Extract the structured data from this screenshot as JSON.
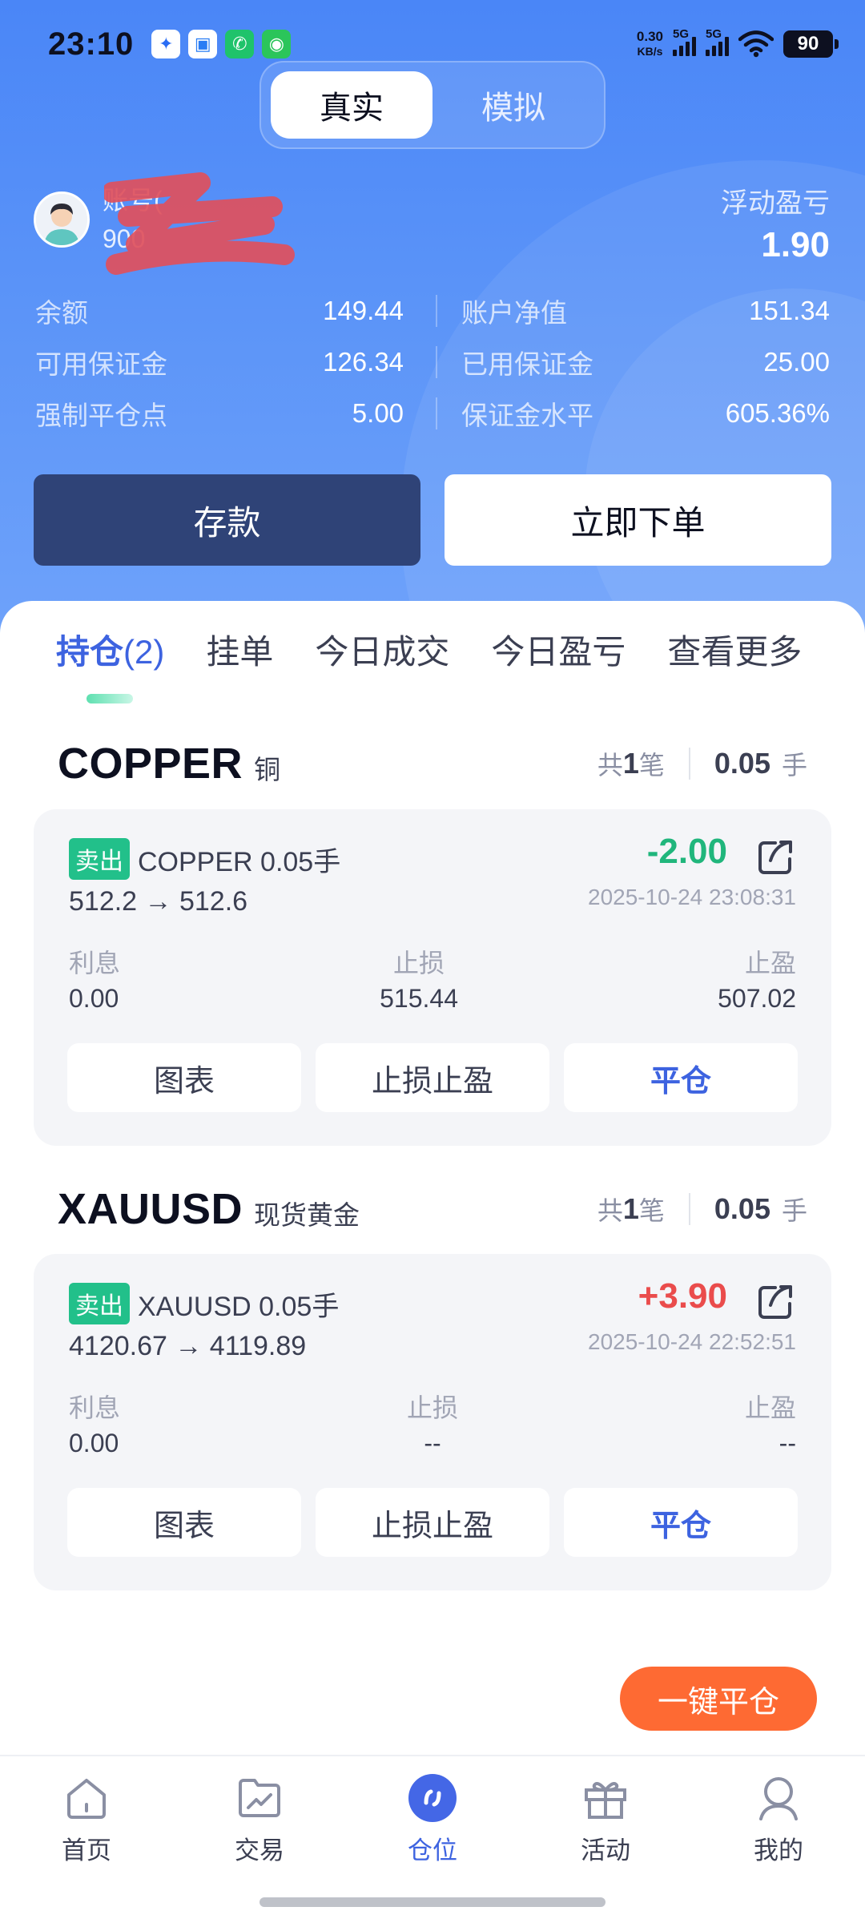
{
  "status_bar": {
    "time": "23:10",
    "net_speed_value": "0.30",
    "net_speed_unit": "KB/s",
    "sim1": "5G",
    "sim2": "5G",
    "battery": "90"
  },
  "mode_toggle": {
    "real": "真实",
    "simulated": "模拟",
    "selected": "真实"
  },
  "account": {
    "label": "账号(",
    "number": "900",
    "floating_pnl_label": "浮动盈亏",
    "floating_pnl_value": "1.90"
  },
  "stats": {
    "balance": {
      "label": "余额",
      "value": "149.44"
    },
    "equity": {
      "label": "账户净值",
      "value": "151.34"
    },
    "free_margin": {
      "label": "可用保证金",
      "value": "126.34"
    },
    "used_margin": {
      "label": "已用保证金",
      "value": "25.00"
    },
    "stop_out": {
      "label": "强制平仓点",
      "value": "5.00"
    },
    "margin_level": {
      "label": "保证金水平",
      "value": "605.36%"
    }
  },
  "actions": {
    "deposit": "存款",
    "place_order": "立即下单"
  },
  "tabs": [
    {
      "label": "持仓",
      "count": "(2)",
      "active": true
    },
    {
      "label": "挂单"
    },
    {
      "label": "今日成交"
    },
    {
      "label": "今日盈亏"
    },
    {
      "label": "查看更多"
    }
  ],
  "positions": [
    {
      "symbol": "COPPER",
      "symbol_cn": "铜",
      "count_prefix": "共",
      "count": "1",
      "count_suffix": "笔",
      "lots": "0.05",
      "lots_unit": "手",
      "side": "卖出",
      "title": "COPPER  0.05手",
      "prices": "512.2 → 512.6",
      "pnl": "-2.00",
      "pnl_color": "#20b67c",
      "time": "2025-10-24 23:08:31",
      "swap_label": "利息",
      "swap": "0.00",
      "sl_label": "止损",
      "sl": "515.44",
      "tp_label": "止盈",
      "tp": "507.02",
      "btn_chart": "图表",
      "btn_sltp": "止损止盈",
      "btn_close": "平仓"
    },
    {
      "symbol": "XAUUSD",
      "symbol_cn": "现货黄金",
      "count_prefix": "共",
      "count": "1",
      "count_suffix": "笔",
      "lots": "0.05",
      "lots_unit": "手",
      "side": "卖出",
      "title": "XAUUSD  0.05手",
      "prices": "4120.67 → 4119.89",
      "pnl": "+3.90",
      "pnl_color": "#ea4c4c",
      "time": "2025-10-24 22:52:51",
      "swap_label": "利息",
      "swap": "0.00",
      "sl_label": "止损",
      "sl": "--",
      "tp_label": "止盈",
      "tp": "--",
      "btn_chart": "图表",
      "btn_sltp": "止损止盈",
      "btn_close": "平仓"
    }
  ],
  "close_all": "一键平仓",
  "bottom_nav": [
    {
      "label": "首页",
      "icon": "home-icon"
    },
    {
      "label": "交易",
      "icon": "trade-chart-icon"
    },
    {
      "label": "仓位",
      "icon": "position-icon",
      "active": true
    },
    {
      "label": "活动",
      "icon": "gift-icon"
    },
    {
      "label": "我的",
      "icon": "profile-icon"
    }
  ],
  "colors": {
    "brand_blue": "#4a86f7",
    "accent_blue": "#3d63e0",
    "deposit_navy": "#2f4377",
    "sell_green": "#22c08a",
    "close_all_orange": "#fe6a33"
  }
}
